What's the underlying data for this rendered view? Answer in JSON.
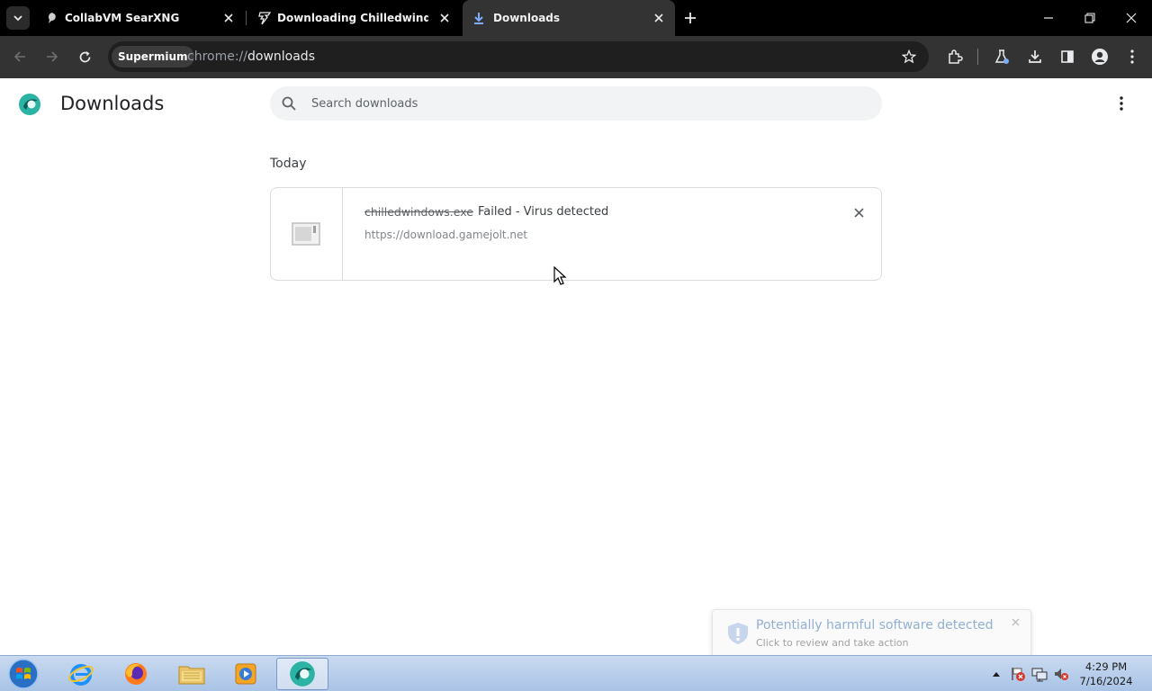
{
  "tabs": [
    {
      "title": "CollabVM SearXNG",
      "icon": "collabvm-icon"
    },
    {
      "title": "Downloading Chilledwindows.exe",
      "icon": "gamejolt-icon"
    },
    {
      "title": "Downloads",
      "icon": "download-icon"
    }
  ],
  "toolbar": {
    "site_chip": "Supermium",
    "url_scheme": "chrome://",
    "url_path": "downloads"
  },
  "page": {
    "title": "Downloads",
    "search_placeholder": "Search downloads",
    "date_header": "Today"
  },
  "download": {
    "file_name": "chilledwindows.exe",
    "status": "Failed - Virus detected",
    "url": "https://download.gamejolt.net"
  },
  "toast": {
    "title": "Potentially harmful software detected",
    "subtitle": "Click to review and take action"
  },
  "taskbar": {
    "apps": [
      "internet-explorer-icon",
      "firefox-icon",
      "file-explorer-icon",
      "media-player-icon",
      "supermium-icon"
    ],
    "time": "4:29 PM",
    "date": "7/16/2024"
  },
  "colors": {
    "tabstrip": "#000000",
    "toolbar": "#333333",
    "accent_teal": "#2bb3a3",
    "taskbar": "#b8cde9"
  }
}
